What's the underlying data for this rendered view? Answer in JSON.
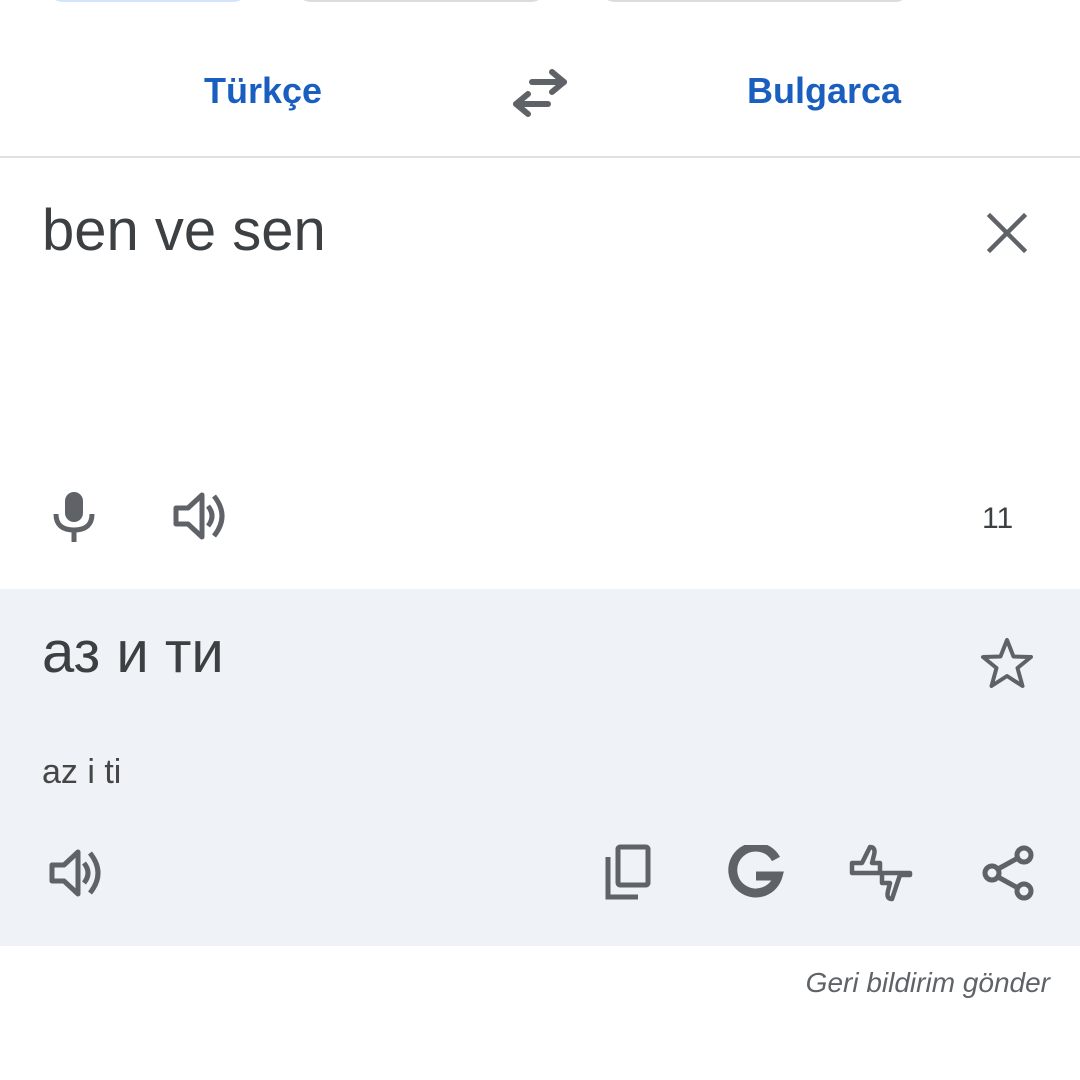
{
  "header": {
    "source_language": "Türkçe",
    "target_language": "Bulgarca"
  },
  "source": {
    "text": "ben ve sen",
    "char_count": "11"
  },
  "result": {
    "translation": "аз и ти",
    "transliteration": "az i ti"
  },
  "footer": {
    "send_feedback": "Geri bildirim gönder"
  },
  "icons": {
    "swap": "swap-horiz-icon",
    "clear": "close-icon",
    "mic": "microphone-icon",
    "speak": "volume-icon",
    "star": "star-outline-icon",
    "copy": "copy-icon",
    "google": "google-g-icon",
    "feedback": "thumbs-up-down-icon",
    "share": "share-icon"
  },
  "colors": {
    "accent": "#1a5fbf",
    "icon": "#5f6368",
    "text": "#3c4043",
    "result_bg": "#eff2f7"
  }
}
